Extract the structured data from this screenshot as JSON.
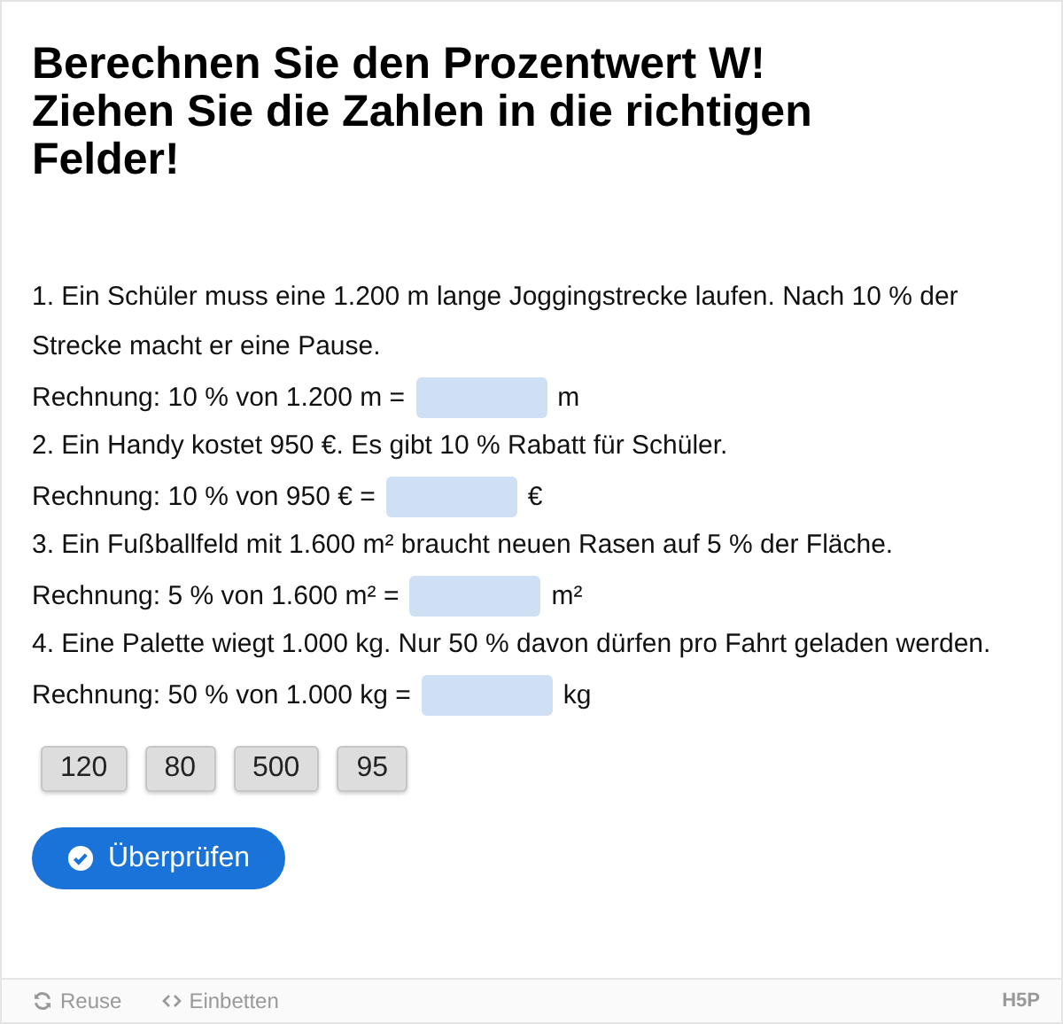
{
  "title_lines": [
    "Berechnen Sie den Prozentwert W!",
    "Ziehen Sie die Zahlen in die richtigen",
    "Felder!"
  ],
  "tasks": [
    {
      "question": "1. Ein Schüler muss eine 1.200 m lange Joggingstrecke laufen. Nach 10 % der Strecke macht er eine Pause.",
      "calculation": "Rechnung: 10 % von 1.200 m =",
      "unit": "m"
    },
    {
      "question": "2. Ein Handy kostet 950 €. Es gibt 10 % Rabatt für Schüler.",
      "calculation": "Rechnung: 10 % von 950 € =",
      "unit": "€"
    },
    {
      "question": "3. Ein Fußballfeld mit 1.600 m² braucht neuen Rasen auf 5 % der Fläche.",
      "calculation": "Rechnung: 5 % von 1.600 m² =",
      "unit": "m²"
    },
    {
      "question": "4. Eine Palette wiegt 1.000 kg. Nur 50 % davon dürfen pro Fahrt geladen werden.",
      "calculation": "Rechnung: 50 % von 1.000 kg =",
      "unit": "kg"
    }
  ],
  "draggables": [
    "120",
    "80",
    "500",
    "95"
  ],
  "check_button": "Überprüfen",
  "footer": {
    "actions": [
      {
        "kind": "reuse",
        "label": "Reuse"
      },
      {
        "kind": "embed",
        "label": "Einbetten"
      }
    ],
    "logo": "H5P"
  }
}
